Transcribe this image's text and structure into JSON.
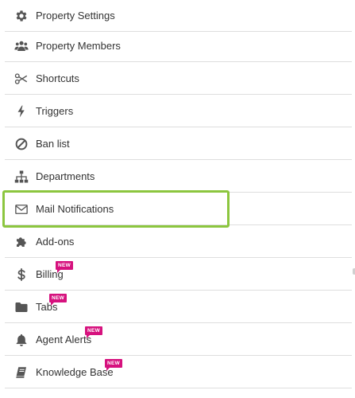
{
  "menu": {
    "items": [
      {
        "label": "Property Settings",
        "icon": "gear-icon"
      },
      {
        "label": "Property Members",
        "icon": "users-icon"
      },
      {
        "label": "Shortcuts",
        "icon": "scissors-icon"
      },
      {
        "label": "Triggers",
        "icon": "bolt-icon"
      },
      {
        "label": "Ban list",
        "icon": "ban-icon"
      },
      {
        "label": "Departments",
        "icon": "sitemap-icon"
      },
      {
        "label": "Mail Notifications",
        "icon": "envelope-icon",
        "highlighted": true
      },
      {
        "label": "Add-ons",
        "icon": "puzzle-icon"
      },
      {
        "label": "Billing",
        "icon": "dollar-icon",
        "badge": "NEW"
      },
      {
        "label": "Tabs",
        "icon": "folder-icon",
        "badge": "NEW"
      },
      {
        "label": "Agent Alerts",
        "icon": "bell-icon",
        "badge": "NEW"
      },
      {
        "label": "Knowledge Base",
        "icon": "book-icon",
        "badge": "NEW"
      }
    ]
  },
  "colors": {
    "text": "#333333",
    "icon": "#555555",
    "divider": "#dedede",
    "highlight_border": "#8cc63f",
    "badge_bg": "#d6127e",
    "badge_text": "#ffffff"
  }
}
